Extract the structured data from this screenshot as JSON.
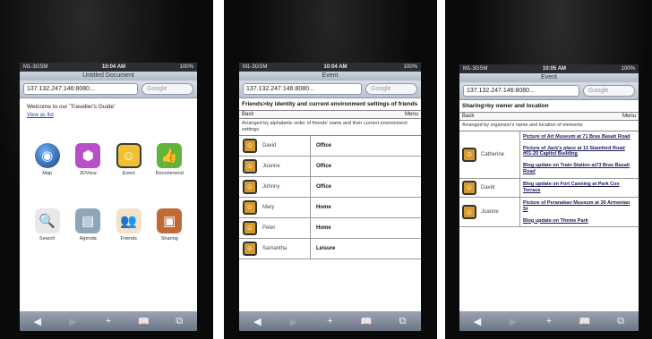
{
  "screens": [
    {
      "status": {
        "carrier": "M1-3GSM",
        "time": "10:04 AM",
        "battery": "100%"
      },
      "title": "Untitled Document",
      "url": "137.132.247.146:8080...",
      "search_placeholder": "Google",
      "welcome": "Welcome to our 'Traveller's Guide'",
      "view_list": "View as list",
      "apps": [
        {
          "label": "Map",
          "icon": "globe-icon",
          "glyph": "◉"
        },
        {
          "label": "3DView",
          "icon": "cube-icon",
          "glyph": "⬢"
        },
        {
          "label": "Event",
          "icon": "event-icon",
          "glyph": "☺"
        },
        {
          "label": "Recommend",
          "icon": "thumbs-up-icon",
          "glyph": "👍"
        },
        {
          "label": "Search",
          "icon": "magnifier-icon",
          "glyph": "🔍"
        },
        {
          "label": "Agenda",
          "icon": "agenda-icon",
          "glyph": "▤"
        },
        {
          "label": "Friends",
          "icon": "friends-icon",
          "glyph": "👥"
        },
        {
          "label": "Sharing",
          "icon": "sharing-icon",
          "glyph": "▣"
        }
      ]
    },
    {
      "status": {
        "carrier": "M1-3GSM",
        "time": "10:04 AM",
        "battery": "100%"
      },
      "title": "Event",
      "url": "137.132.247.146:8080...",
      "search_placeholder": "Google",
      "heading": "Friends>by identity and current environment settings of friends",
      "back": "Back",
      "menu": "Menu",
      "description": "Arranged by alphabetic order of friends' name and their current environment settings",
      "friends": [
        {
          "name": "David",
          "env": "Office"
        },
        {
          "name": "Joanne",
          "env": "Office"
        },
        {
          "name": "Johnny",
          "env": "Office"
        },
        {
          "name": "Mary",
          "env": "Home"
        },
        {
          "name": "Peter",
          "env": "Home"
        },
        {
          "name": "Samantha",
          "env": "Leisure"
        }
      ]
    },
    {
      "status": {
        "carrier": "M1-3GSM",
        "time": "10:05 AM",
        "battery": "100%"
      },
      "title": "Event",
      "url": "137.132.247.146:8080...",
      "search_placeholder": "Google",
      "heading": "Sharing>by owner and location",
      "back": "Back",
      "menu": "Menu",
      "description": "Arranged by organizer's name and location of elements",
      "groups": [
        {
          "name": "Catherine",
          "items": [
            "Picture of Art Museum at 71 Bras Basah Road",
            "Picture of Jack's place at 11 Stamford Road #01-20 Capitol Building",
            "Blog update on Train Station at73 Bras Basah Road"
          ]
        },
        {
          "name": "David",
          "items": [
            "Blog update on Fort Canning at Park Cox Terrace"
          ]
        },
        {
          "name": "Joanne",
          "items": [
            "Picture of Peranakan Museum at 39 Armenian St",
            "Blog update on Theme Park"
          ]
        }
      ]
    }
  ],
  "toolbar": {
    "back": "◀",
    "forward": "▶",
    "add": "+",
    "bookmarks": "📖",
    "pages": "⧉"
  }
}
